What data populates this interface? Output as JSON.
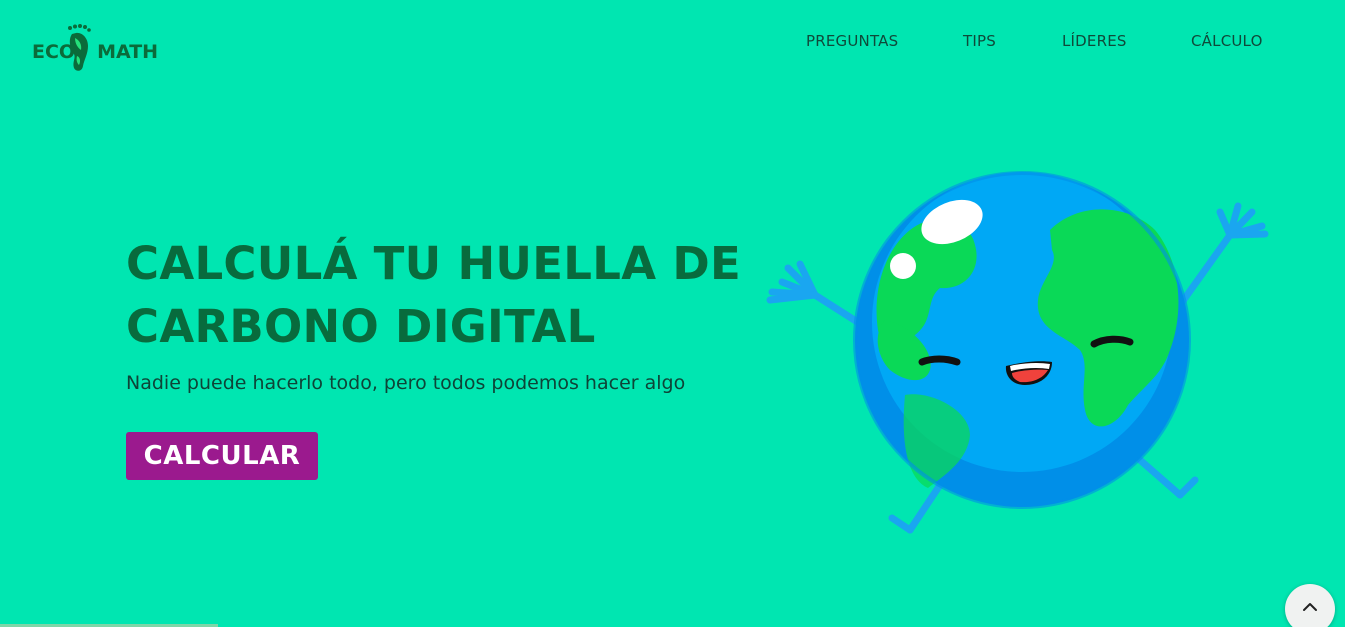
{
  "header": {
    "logo": {
      "text_left": "ECO",
      "text_right": "MATH",
      "icon": "footprint-leaf-icon"
    },
    "nav": [
      {
        "label": "PREGUNTAS"
      },
      {
        "label": "TIPS"
      },
      {
        "label": "LÍDERES"
      },
      {
        "label": "CÁLCULO"
      }
    ]
  },
  "hero": {
    "title_line1": "CALCULÁ TU HUELLA DE",
    "title_line2": "CARBONO DIGITAL",
    "subtitle": "Nadie puede hacerlo todo, pero todos podemos hacer algo",
    "cta_label": "CALCULAR",
    "illustration": "happy-earth-illustration"
  },
  "scroll_top": {
    "icon": "chevron-up-icon"
  },
  "colors": {
    "background": "#00e6b1",
    "title": "#086b3d",
    "cta": "#9b1a8e",
    "earth_ocean": "#00a8f0",
    "earth_land": "#0ad957"
  }
}
